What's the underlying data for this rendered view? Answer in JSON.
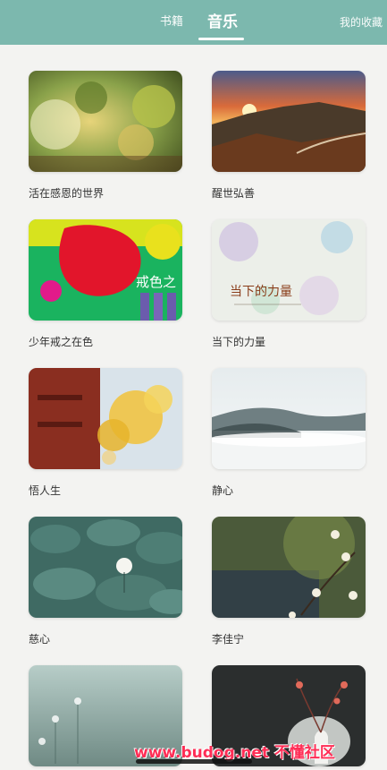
{
  "tabs": {
    "books": "书籍",
    "music": "音乐",
    "favorites": "我的收藏"
  },
  "albums": [
    {
      "title": "活在感恩的世界"
    },
    {
      "title": "醒世弘善"
    },
    {
      "title": "少年戒之在色",
      "overlay_text": "戒色之"
    },
    {
      "title": "当下的力量",
      "overlay_text": "当下的力量"
    },
    {
      "title": "悟人生"
    },
    {
      "title": "静心"
    },
    {
      "title": "慈心"
    },
    {
      "title": "李佳宁"
    },
    {
      "title": ""
    },
    {
      "title": ""
    }
  ],
  "watermark": "www.budog.net 不懂社区",
  "colors": {
    "header": "#7cb8ae",
    "background": "#f3f3f1"
  }
}
